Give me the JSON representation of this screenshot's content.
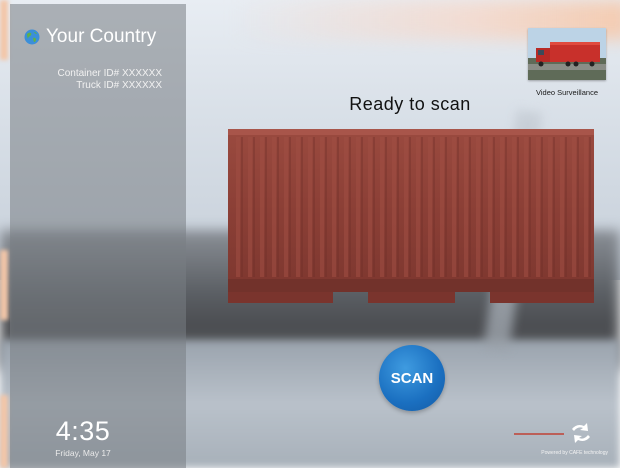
{
  "left_panel": {
    "country": "Your Country",
    "container_id": "Container ID# XXXXXX",
    "truck_id": "Truck ID# XXXXXX",
    "time": "4:35",
    "date": "Friday, May 17"
  },
  "video": {
    "label": "Video Surveillance"
  },
  "main": {
    "status": "Ready to scan",
    "scan_label": "SCAN"
  },
  "footer": {
    "powered_by": "Powered by CAFE technology"
  },
  "icons": [
    "globe-icon",
    "truck-thumbnail",
    "shipping-container",
    "brand-logo-icon"
  ],
  "colors": {
    "container": "#8b3f36",
    "scan_button": "#1a6fc0",
    "panel": "#787d84"
  }
}
